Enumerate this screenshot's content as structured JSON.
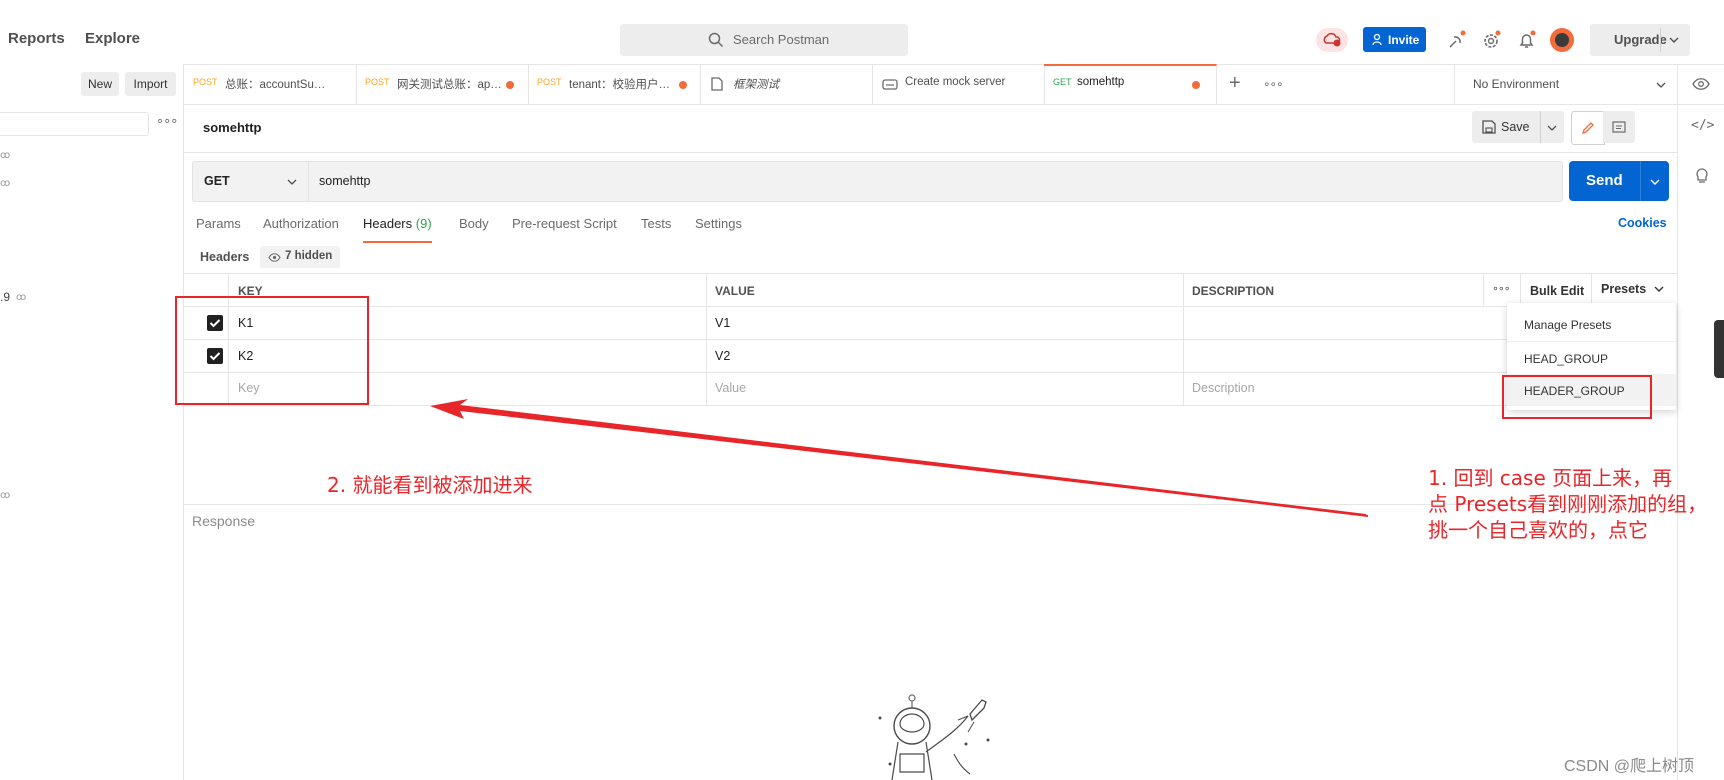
{
  "topbar": {
    "nav": [
      "Reports",
      "Explore"
    ],
    "search_placeholder": "Search Postman",
    "invite_label": "Invite",
    "upgrade_label": "Upgrade"
  },
  "sidebar": {
    "new_label": "New",
    "import_label": "Import",
    "item_fragment": ".9"
  },
  "tabs": [
    {
      "method": "POST",
      "name": "总账：accountSu…",
      "dirty": false
    },
    {
      "method": "POST",
      "name": "网关测试总账：ap…",
      "dirty": true
    },
    {
      "method": "POST",
      "name": "tenant：校验用户…",
      "dirty": true
    },
    {
      "method": "",
      "name": "框架测试",
      "dirty": false
    },
    {
      "method": "",
      "name": "Create mock server",
      "dirty": false
    },
    {
      "method": "GET",
      "name": "somehttp",
      "dirty": true
    }
  ],
  "environment": "No Environment",
  "request": {
    "title": "somehttp",
    "save_label": "Save",
    "method": "GET",
    "url": "somehttp",
    "send_label": "Send",
    "subtabs": [
      "Params",
      "Authorization",
      "Headers",
      "Body",
      "Pre-request Script",
      "Tests",
      "Settings"
    ],
    "headers_count": "(9)",
    "cookies_label": "Cookies"
  },
  "headers_section": {
    "label": "Headers",
    "hidden_label": "7 hidden",
    "columns": [
      "KEY",
      "VALUE",
      "DESCRIPTION"
    ],
    "bulk_edit_label": "Bulk Edit",
    "presets_label": "Presets",
    "rows": [
      {
        "key": "K1",
        "value": "V1",
        "checked": true
      },
      {
        "key": "K2",
        "value": "V2",
        "checked": true
      }
    ],
    "placeholder": {
      "key": "Key",
      "value": "Value",
      "description": "Description"
    }
  },
  "presets_menu": [
    "Manage Presets",
    "HEAD_GROUP",
    "HEADER_GROUP"
  ],
  "response_label": "Response",
  "annotations": {
    "left": "2. 就能看到被添加进来",
    "right": [
      "1. 回到 case 页面上来，再",
      "点 Presets看到刚刚添加的组，",
      "挑一个自己喜欢的，点它"
    ],
    "watermark": "CSDN @爬上树顶"
  },
  "colors": {
    "accent": "#f26b3a",
    "primary": "#0265d2",
    "annotation": "#e8262a",
    "post": "#f5a623",
    "get": "#2ea44f"
  }
}
